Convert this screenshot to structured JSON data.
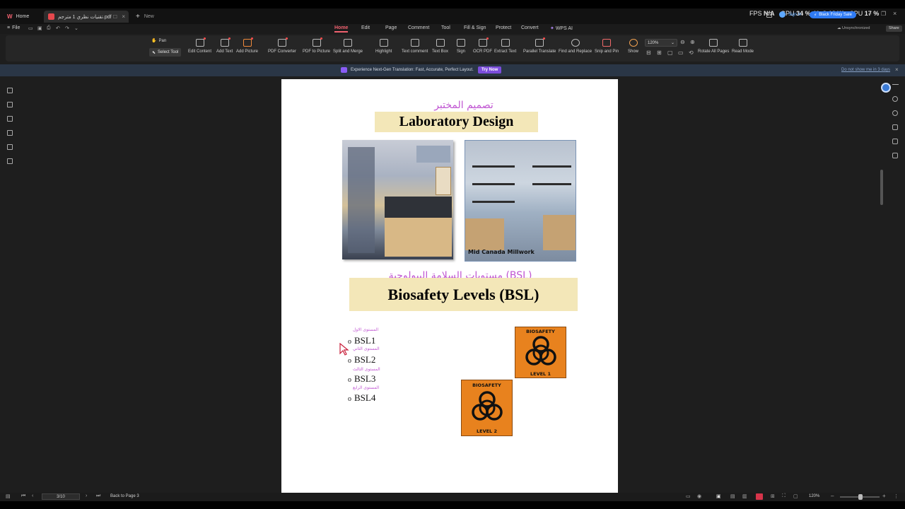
{
  "tabs": {
    "home_label": "Home",
    "doc_label": "تقنيات نظري 1 مترجم.pdf",
    "new_label": "New"
  },
  "perf": {
    "fps_label": "FPS",
    "fps_value": "N/A",
    "gpu_label": "GPU",
    "gpu_value": "34 % 40°C 18 W",
    "cpu_label": "CPU",
    "cpu_value": "17 %"
  },
  "account": {
    "sign_in": "Sign in",
    "promo": "Black Friday Sale",
    "sync": "Unsynchronized",
    "share": "Share"
  },
  "menu": {
    "file": "File",
    "tabs": [
      "Home",
      "Edit",
      "Page",
      "Comment",
      "Tool",
      "Fill & Sign",
      "Protect",
      "Convert",
      "WPS AI"
    ]
  },
  "toolbar": {
    "pan": "Pan",
    "select_tool": "Select Tool",
    "edit_content": "Edit Content",
    "add_text": "Add Text",
    "add_picture": "Add Picture",
    "pdf_converter": "PDF Converter",
    "pdf_to_picture": "PDF to Picture",
    "split_merge": "Split and Merge",
    "highlight": "Highlight",
    "text_comment": "Text comment",
    "text_box": "Text Box",
    "sign": "Sign",
    "ocr_pdf": "OCR PDF",
    "extract_text": "Extract Text",
    "parallel_translate": "Parallel Translate",
    "find_replace": "Find and Replace",
    "snip_pin": "Snip and Pin",
    "show": "Show",
    "zoom_value": "120%",
    "rotate_all": "Rotate All Pages",
    "read_mode": "Read Mode"
  },
  "banner": {
    "message": "Experience Next-Gen Translation: Fast, Accurate, Perfect Layout.",
    "cta": "Try Now",
    "dismiss": "Do not show me in 3 days"
  },
  "document": {
    "lab_ar": "تصميم المختبر",
    "lab_en": "Laboratory Design",
    "photo_caption": "Mid Canada Millwork",
    "bsl_ar": "مستويات السلامة البيولوجية (BSL)",
    "bsl_en": "Biosafety Levels (BSL)",
    "levels": [
      {
        "ar": "المستوى الاول",
        "en": "BSL1"
      },
      {
        "ar": "المستوى الثاني",
        "en": "BSL2"
      },
      {
        "ar": "المستوى الثالث",
        "en": "BSL3"
      },
      {
        "ar": "المستوى الرابع",
        "en": "BSL4"
      }
    ],
    "sign1_top": "BIOSAFETY",
    "sign1_bottom": "LEVEL 1",
    "sign2_top": "BIOSAFETY",
    "sign2_bottom": "LEVEL 2"
  },
  "status": {
    "page_value": "3/10",
    "back_label": "Back to Page 3",
    "zoom_value": "120%"
  },
  "colors": {
    "accent": "#f0616f",
    "arabic_text": "#c055d2",
    "title_box": "#f3e7b8",
    "sign_orange": "#e8821e"
  }
}
